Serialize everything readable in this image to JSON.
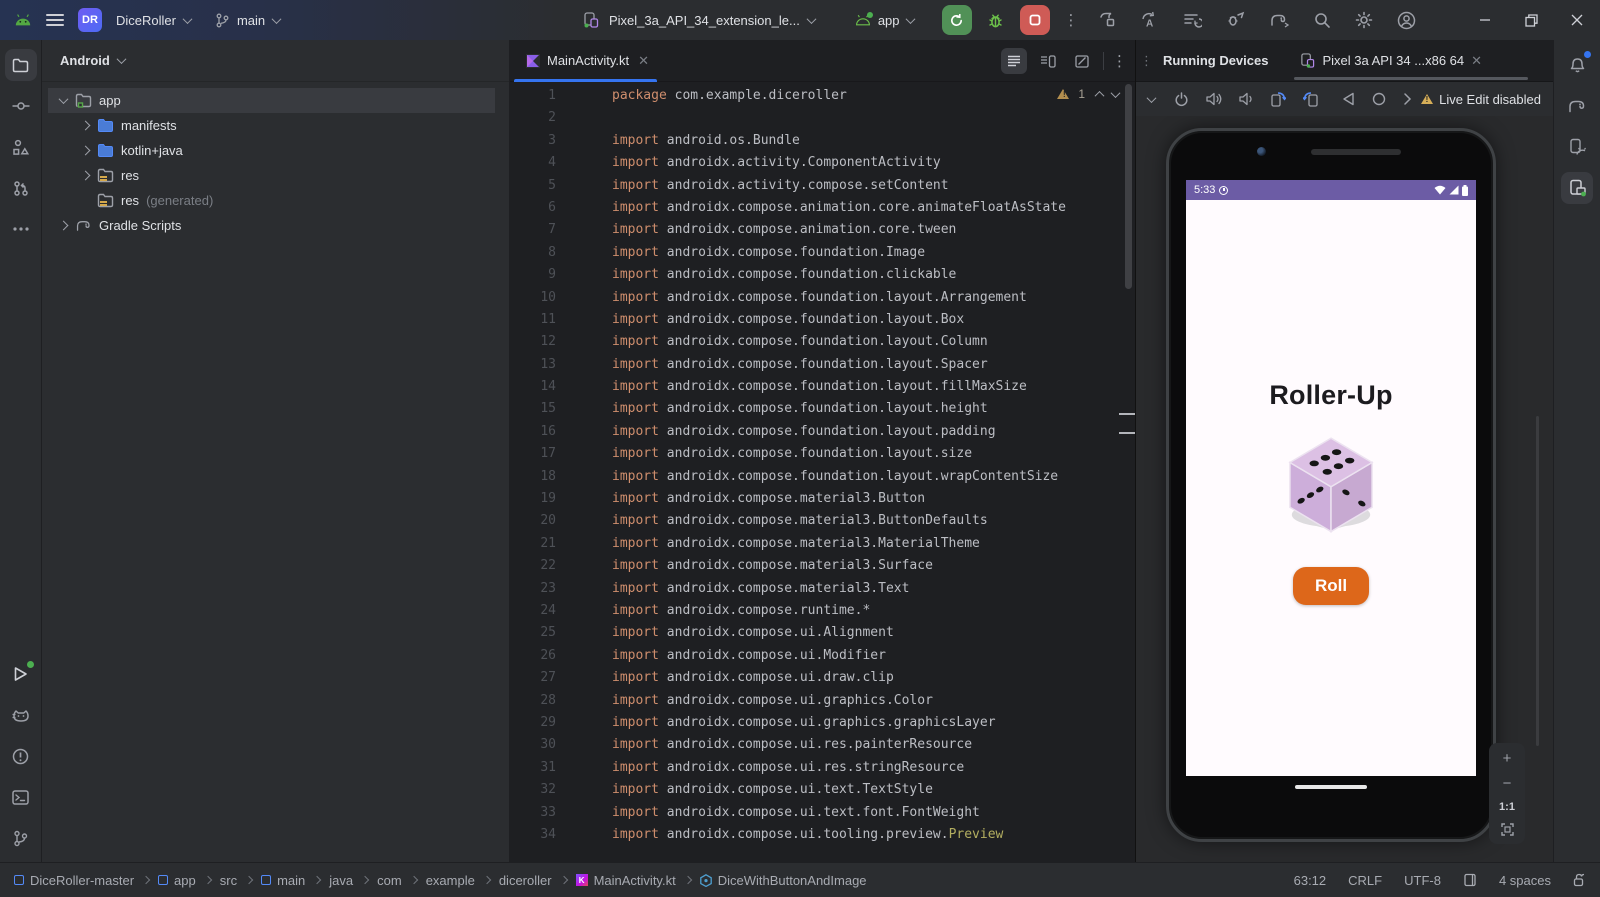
{
  "titlebar": {
    "project_badge": "DR",
    "project_name": "DiceRoller",
    "branch_name": "main",
    "run_config": "Pixel_3a_API_34_extension_le...",
    "module": "app"
  },
  "project_panel": {
    "view_selector": "Android",
    "tree": [
      {
        "label": "app",
        "type": "app",
        "depth": 1,
        "chevron": "down",
        "selected": true
      },
      {
        "label": "manifests",
        "type": "folder",
        "depth": 2,
        "chevron": "right",
        "selected": false
      },
      {
        "label": "kotlin+java",
        "type": "folder",
        "depth": 2,
        "chevron": "right",
        "selected": false
      },
      {
        "label": "res",
        "type": "res",
        "depth": 2,
        "chevron": "right",
        "selected": false
      },
      {
        "label": "res",
        "suffix": "(generated)",
        "type": "res",
        "depth": 2,
        "chevron": "none",
        "selected": false
      },
      {
        "label": "Gradle Scripts",
        "type": "gradle",
        "depth": 1,
        "chevron": "right",
        "selected": false
      }
    ]
  },
  "editor": {
    "tab_title": "MainActivity.kt",
    "warning_count": "1",
    "code_lines": [
      {
        "n": "1",
        "kw": "package",
        "rest": "com.example.diceroller"
      },
      {
        "n": "2"
      },
      {
        "n": "3",
        "kw": "import",
        "rest": "android.os.Bundle"
      },
      {
        "n": "4",
        "kw": "import",
        "rest": "androidx.activity.ComponentActivity"
      },
      {
        "n": "5",
        "kw": "import",
        "rest": "androidx.activity.compose.setContent"
      },
      {
        "n": "6",
        "kw": "import",
        "rest": "androidx.compose.animation.core.animateFloatAsState"
      },
      {
        "n": "7",
        "kw": "import",
        "rest": "androidx.compose.animation.core.tween"
      },
      {
        "n": "8",
        "kw": "import",
        "rest": "androidx.compose.foundation.Image"
      },
      {
        "n": "9",
        "kw": "import",
        "rest": "androidx.compose.foundation.clickable"
      },
      {
        "n": "10",
        "kw": "import",
        "rest": "androidx.compose.foundation.layout.Arrangement"
      },
      {
        "n": "11",
        "kw": "import",
        "rest": "androidx.compose.foundation.layout.Box"
      },
      {
        "n": "12",
        "kw": "import",
        "rest": "androidx.compose.foundation.layout.Column"
      },
      {
        "n": "13",
        "kw": "import",
        "rest": "androidx.compose.foundation.layout.Spacer"
      },
      {
        "n": "14",
        "kw": "import",
        "rest": "androidx.compose.foundation.layout.fillMaxSize"
      },
      {
        "n": "15",
        "kw": "import",
        "rest": "androidx.compose.foundation.layout.height"
      },
      {
        "n": "16",
        "kw": "import",
        "rest": "androidx.compose.foundation.layout.padding"
      },
      {
        "n": "17",
        "kw": "import",
        "rest": "androidx.compose.foundation.layout.size"
      },
      {
        "n": "18",
        "kw": "import",
        "rest": "androidx.compose.foundation.layout.wrapContentSize"
      },
      {
        "n": "19",
        "kw": "import",
        "rest": "androidx.compose.material3.Button"
      },
      {
        "n": "20",
        "kw": "import",
        "rest": "androidx.compose.material3.ButtonDefaults"
      },
      {
        "n": "21",
        "kw": "import",
        "rest": "androidx.compose.material3.MaterialTheme"
      },
      {
        "n": "22",
        "kw": "import",
        "rest": "androidx.compose.material3.Surface"
      },
      {
        "n": "23",
        "kw": "import",
        "rest": "androidx.compose.material3.Text"
      },
      {
        "n": "24",
        "kw": "import",
        "rest": "androidx.compose.runtime.*"
      },
      {
        "n": "25",
        "kw": "import",
        "rest": "androidx.compose.ui.Alignment"
      },
      {
        "n": "26",
        "kw": "import",
        "rest": "androidx.compose.ui.Modifier"
      },
      {
        "n": "27",
        "kw": "import",
        "rest": "androidx.compose.ui.draw.clip"
      },
      {
        "n": "28",
        "kw": "import",
        "rest": "androidx.compose.ui.graphics.Color"
      },
      {
        "n": "29",
        "kw": "import",
        "rest": "androidx.compose.ui.graphics.graphicsLayer"
      },
      {
        "n": "30",
        "kw": "import",
        "rest": "androidx.compose.ui.res.painterResource"
      },
      {
        "n": "31",
        "kw": "import",
        "rest": "androidx.compose.ui.res.stringResource"
      },
      {
        "n": "32",
        "kw": "import",
        "rest": "androidx.compose.ui.text.TextStyle"
      },
      {
        "n": "33",
        "kw": "import",
        "rest": "androidx.compose.ui.text.font.FontWeight"
      },
      {
        "n": "34",
        "kw": "import",
        "rest": "androidx.compose.ui.tooling.preview.",
        "ann": "Preview"
      }
    ]
  },
  "devices": {
    "panel_title": "Running Devices",
    "tab_label": "Pixel 3a API 34 ...x86 64",
    "live_edit_status": "Live Edit disabled",
    "zoom_level": "1:1"
  },
  "emulator": {
    "status_time": "5:33",
    "app_title": "Roller-Up",
    "roll_label": "Roll",
    "dice": {
      "top_pips": 6,
      "left_pips": 3,
      "right_pips": 2
    }
  },
  "statusbar": {
    "breadcrumbs": [
      {
        "label": "DiceRoller-master",
        "icon": "module"
      },
      {
        "label": "app",
        "icon": "module"
      },
      {
        "label": "src",
        "icon": "none"
      },
      {
        "label": "main",
        "icon": "module"
      },
      {
        "label": "java",
        "icon": "none"
      },
      {
        "label": "com",
        "icon": "none"
      },
      {
        "label": "example",
        "icon": "none"
      },
      {
        "label": "diceroller",
        "icon": "none"
      },
      {
        "label": "MainActivity.kt",
        "icon": "kotlin"
      },
      {
        "label": "DiceWithButtonAndImage",
        "icon": "compose"
      }
    ],
    "cursor_position": "63:12",
    "line_separator": "CRLF",
    "encoding": "UTF-8",
    "indent": "4 spaces"
  },
  "colors": {
    "keyword_orange": "#cf8e6d",
    "annotation_yellow": "#b3ae60",
    "accent_blue": "#3574f0",
    "run_green": "#519157",
    "stop_red": "#cf5b56",
    "roll_orange": "#dd671a",
    "emulator_statusbar_purple": "#6c5ca5",
    "dice_top": "#dcc0e4",
    "dice_left": "#cdaeda",
    "dice_right": "#c7a9d1"
  }
}
